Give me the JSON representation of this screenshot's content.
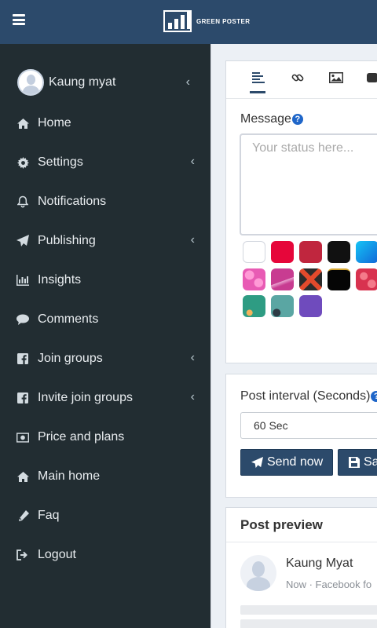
{
  "header": {
    "logo_text": "GREEN POSTER"
  },
  "sidebar": {
    "user": {
      "name": "Kaung myat"
    },
    "items": [
      {
        "label": "Home",
        "icon": "home-icon",
        "has_submenu": false
      },
      {
        "label": "Settings",
        "icon": "gear-icon",
        "has_submenu": true
      },
      {
        "label": "Notifications",
        "icon": "bell-icon",
        "has_submenu": false
      },
      {
        "label": "Publishing",
        "icon": "paper-plane-icon",
        "has_submenu": true
      },
      {
        "label": "Insights",
        "icon": "bar-chart-icon",
        "has_submenu": false
      },
      {
        "label": "Comments",
        "icon": "comment-icon",
        "has_submenu": false
      },
      {
        "label": "Join groups",
        "icon": "facebook-icon",
        "has_submenu": true
      },
      {
        "label": "Invite join groups",
        "icon": "facebook-icon",
        "has_submenu": true
      },
      {
        "label": "Price and plans",
        "icon": "money-icon",
        "has_submenu": false
      },
      {
        "label": "Main home",
        "icon": "home-icon",
        "has_submenu": false
      },
      {
        "label": "Faq",
        "icon": "pencil-icon",
        "has_submenu": false
      },
      {
        "label": "Logout",
        "icon": "sign-out-icon",
        "has_submenu": false
      }
    ]
  },
  "composer": {
    "tabs": [
      {
        "icon": "text-align-icon",
        "active": true
      },
      {
        "icon": "link-icon",
        "active": false
      },
      {
        "icon": "image-icon",
        "active": false
      },
      {
        "icon": "video-icon",
        "active": false
      }
    ],
    "message_label": "Message",
    "help_glyph": "?",
    "message_placeholder": "Your status here...",
    "backgrounds": [
      {
        "color": "#ffffff",
        "pattern": "plain"
      },
      {
        "color": "#e6063a",
        "pattern": "plain"
      },
      {
        "color": "#c0263e",
        "pattern": "plain"
      },
      {
        "color": "#111111",
        "pattern": "plain"
      },
      {
        "color": "#1aa3e8",
        "pattern": "gradient"
      },
      {
        "color": "#e85bb4",
        "pattern": "hearts"
      },
      {
        "color": "#c83c91",
        "pattern": "ribbon"
      },
      {
        "color": "#2b2b2b",
        "pattern": "cross"
      },
      {
        "color": "#050505",
        "pattern": "sparkle"
      },
      {
        "color": "#d8324f",
        "pattern": "hearts"
      },
      {
        "color": "#2e9c83",
        "pattern": "flowers"
      },
      {
        "color": "#5aa6a3",
        "pattern": "figure"
      },
      {
        "color": "#6f4bbd",
        "pattern": "plain"
      }
    ]
  },
  "interval": {
    "label": "Post interval (Seconds)",
    "help_glyph": "?",
    "selected": "60 Sec",
    "send_label": "Send now",
    "save_label": "Sav"
  },
  "preview": {
    "title": "Post preview",
    "name": "Kaung Myat",
    "meta": "Now · Facebook fo"
  },
  "colors": {
    "topbar": "#2c4a6b",
    "sidebar": "#222d32",
    "button": "#2c4a6b",
    "help": "#1f66c9"
  }
}
